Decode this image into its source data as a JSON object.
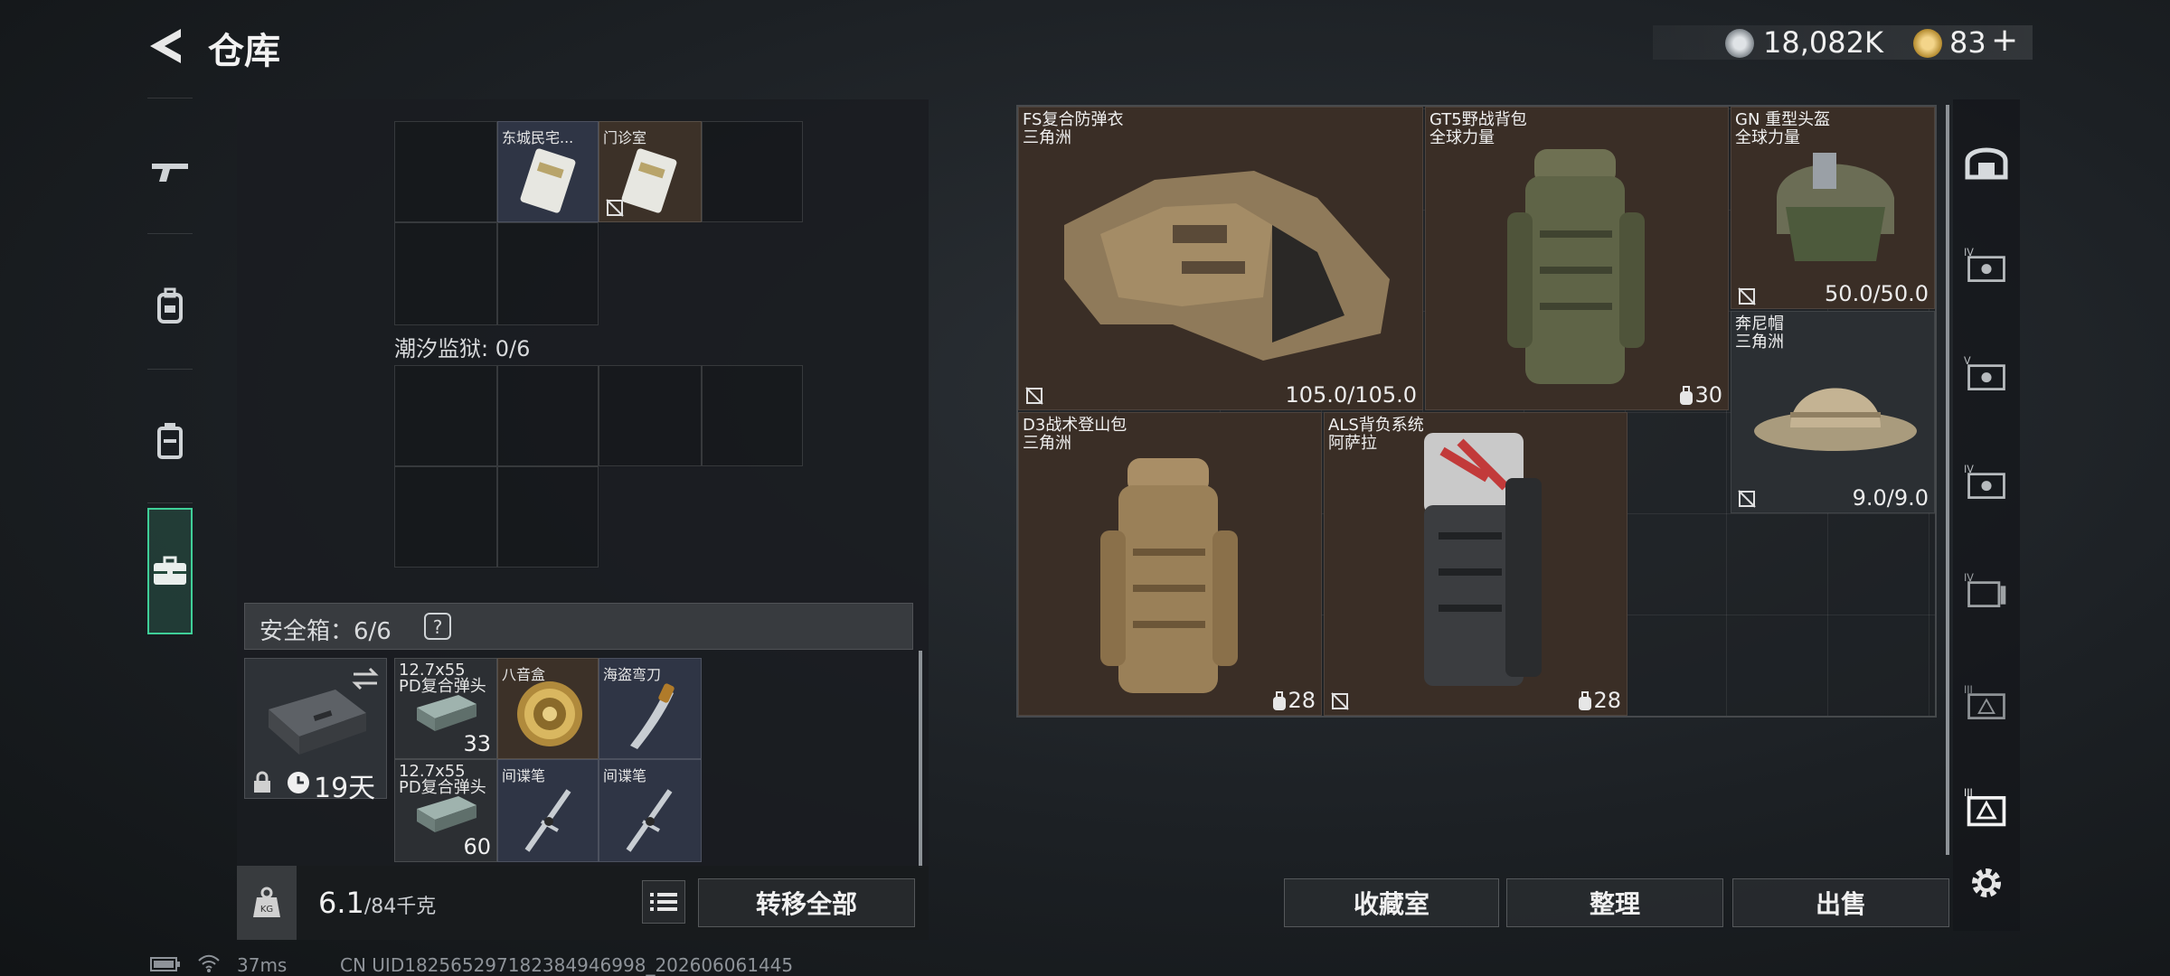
{
  "header": {
    "title": "仓库",
    "currency": "18,082K",
    "coupons": "83",
    "plus": "+"
  },
  "left_rail": {
    "tabs": [
      "gun",
      "backpack",
      "vest",
      "case"
    ],
    "active": 3
  },
  "container1": {
    "items": [
      {
        "name": "东城民宅...",
        "type": "keycard"
      },
      {
        "name": "门诊室",
        "type": "keycard"
      }
    ]
  },
  "container2": {
    "label": "潮汐监狱: 0/6"
  },
  "safebox": {
    "label": "安全箱：6/6",
    "help": "?",
    "days": "19天",
    "items": [
      {
        "name": "12.7x55 PD复合弹头",
        "count": "33"
      },
      {
        "name": "八音盒",
        "count": ""
      },
      {
        "name": "海盗弯刀",
        "count": ""
      },
      {
        "name": "12.7x55 PD复合弹头",
        "count": "60"
      },
      {
        "name": "间谍笔",
        "count": ""
      },
      {
        "name": "间谍笔",
        "count": ""
      }
    ]
  },
  "bottom": {
    "weight_value": "6.1",
    "weight_max": "/84千克",
    "transfer_all": "转移全部"
  },
  "gear": {
    "armor": {
      "name": "FS复合防弹衣",
      "source": "三角洲",
      "durability": "105.0/105.0"
    },
    "backpack": {
      "name": "GT5野战背包",
      "source": "全球力量",
      "capacity": "30"
    },
    "helmet": {
      "name": "GN 重型头盔",
      "source": "全球力量",
      "durability": "50.0/50.0"
    },
    "hat": {
      "name": "奔尼帽",
      "source": "三角洲",
      "durability": "9.0/9.0"
    },
    "pack2": {
      "name": "D3战术登山包",
      "source": "三角洲",
      "capacity": "28"
    },
    "pack3": {
      "name": "ALS背负系统",
      "source": "阿萨拉",
      "capacity": "28"
    }
  },
  "actions": {
    "collection": "收藏室",
    "sort": "整理",
    "sell": "出售"
  },
  "status": {
    "ping": "37ms",
    "uid": "CN UID1825652971823849469​98_202606061445"
  }
}
